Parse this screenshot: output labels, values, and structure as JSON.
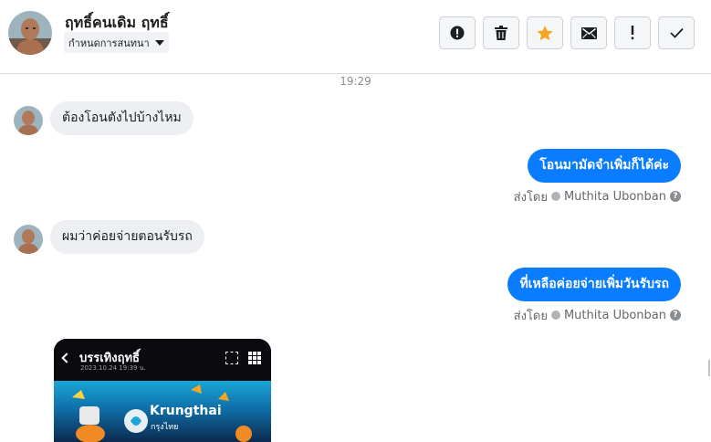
{
  "header": {
    "contact_name": "ฤทธิ์คนเดิม ฤทธิ์",
    "assign_label": "กำหนดการสนทนา",
    "toolbar": [
      {
        "name": "spam-button",
        "icon": "alert-circle-icon"
      },
      {
        "name": "delete-button",
        "icon": "trash-icon"
      },
      {
        "name": "star-button",
        "icon": "star-icon"
      },
      {
        "name": "mark-unread-button",
        "icon": "envelope-icon"
      },
      {
        "name": "follow-up-button",
        "icon": "exclamation-icon"
      },
      {
        "name": "done-button",
        "icon": "check-icon"
      }
    ]
  },
  "conversation": {
    "timestamp": "19:29",
    "messages": [
      {
        "direction": "in",
        "text": "ต้องโอนตังไปบ้างไหม"
      },
      {
        "direction": "out",
        "text": "โอนมามัดจำเพิ่มก็ได้ค่ะ",
        "sent_by_label": "ส่งโดย",
        "sender": "Muthita Ubonban"
      },
      {
        "direction": "in",
        "text": "ผมว่าค่อยจ่ายตอนรับรถ"
      },
      {
        "direction": "out",
        "text": "ที่เหลือค่อยจ่ายเพิ่มวันรับรถ",
        "sent_by_label": "ส่งโดย",
        "sender": "Muthita Ubonban"
      }
    ],
    "attachment": {
      "title": "บรรเทิงฤทธิ์",
      "subtitle": "2023.10.24 19:39 น.",
      "bank_name": "Krungthai",
      "bank_sub": "กรุงไทย"
    }
  },
  "colors": {
    "accent": "#0a7cff",
    "star": "#f5a623",
    "incoming_bubble": "#eeeff2"
  }
}
